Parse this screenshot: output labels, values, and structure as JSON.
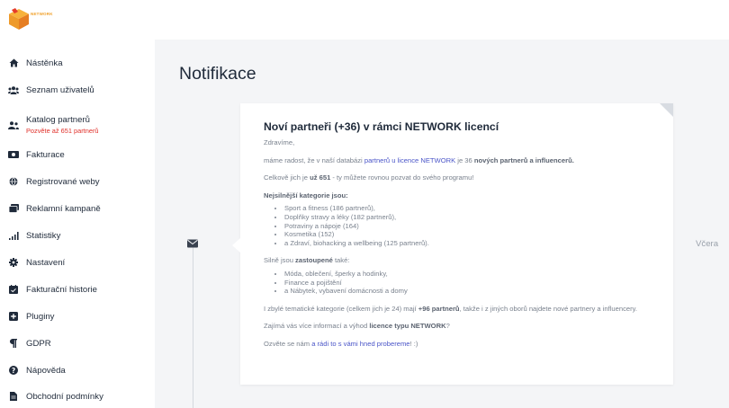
{
  "brand": {
    "logo_text": "NETWORK",
    "accent": "#f0a02a"
  },
  "sidebar": {
    "items": [
      {
        "label": "Nástěnka",
        "icon": "home-icon"
      },
      {
        "label": "Seznam uživatelů",
        "icon": "users-icon"
      },
      {
        "label": "Katalog partnerů",
        "sub": "Pozvěte až 651 partnerů",
        "icon": "partners-icon"
      },
      {
        "label": "Fakturace",
        "icon": "money-icon"
      },
      {
        "label": "Registrované weby",
        "icon": "globe-icon"
      },
      {
        "label": "Reklamní kampaně",
        "icon": "campaign-icon"
      },
      {
        "label": "Statistiky",
        "icon": "signal-icon"
      },
      {
        "label": "Nastavení",
        "icon": "gear-icon"
      },
      {
        "label": "Fakturační historie",
        "icon": "calendar-icon"
      },
      {
        "label": "Pluginy",
        "icon": "plus-icon"
      },
      {
        "label": "GDPR",
        "icon": "paragraph-icon"
      },
      {
        "label": "Nápověda",
        "icon": "help-icon"
      },
      {
        "label": "Obchodní podmínky",
        "icon": "document-icon"
      }
    ]
  },
  "main": {
    "title": "Notifikace",
    "date": "Včera",
    "card": {
      "title": "Noví partneři (+36) v rámci NETWORK licencí",
      "greeting": "Zdravíme,",
      "p1_a": "máme radost, že v naší databázi ",
      "p1_link": "partnerů u licence NETWORK",
      "p1_b": " je 36 ",
      "p1_strong": "nových partnerů a influencerů.",
      "p2_a": "Celkově jich je ",
      "p2_strong": "už 651",
      "p2_b": " - ty můžete rovnou pozvat do svého programu!",
      "strongest_heading": "Nejsilnější kategorie jsou:",
      "strongest": [
        "Sport a fitness (186 partnerů),",
        "Doplňky stravy a léky (182 partnerů),",
        "Potraviny a nápoje (164)",
        "Kosmetika (152)",
        "a Zdraví, biohacking a wellbeing (125 partnerů)."
      ],
      "p3_a": "Silně jsou ",
      "p3_strong": "zastoupené",
      "p3_b": " také:",
      "also": [
        "Móda, oblečení, šperky a hodinky,",
        "Finance a pojištění",
        "a Nábytek, vybavení domácnosti a domy"
      ],
      "p4_a": "I zbylé tematické kategorie (celkem jich je 24) mají ",
      "p4_strong": "+96 partnerů",
      "p4_b": ", takže i z jiných oborů najdete nové partnery a influencery.",
      "p5_a": "Zajímá vás více informací a výhod ",
      "p5_strong": "licence typu NETWORK",
      "p5_b": "?",
      "p6_a": "Ozvěte se nám ",
      "p6_link": "a rádi to s vámi hned probereme",
      "p6_b": "! :)"
    }
  }
}
